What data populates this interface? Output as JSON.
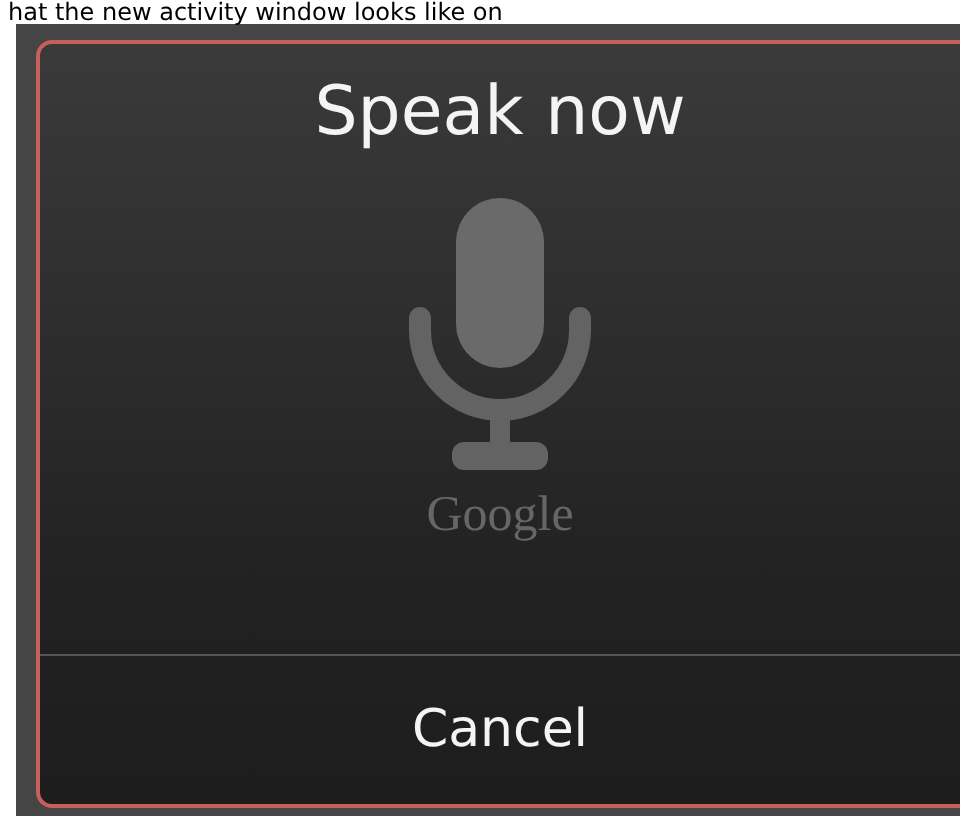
{
  "caption": "hat the new activity window looks like on",
  "dialog": {
    "title": "Speak now",
    "logo_text": "Google",
    "buttons": [
      "Cancel"
    ]
  }
}
